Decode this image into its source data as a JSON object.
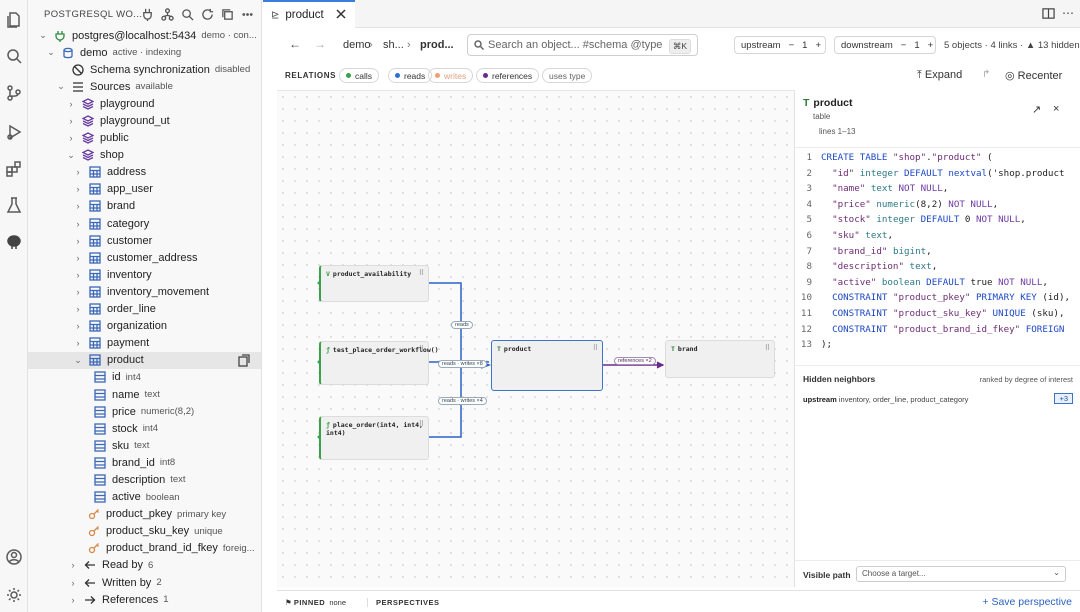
{
  "sidebar": {
    "title": "POSTGRESQL WO...",
    "connection": {
      "label": "postgres@localhost:5434",
      "suffix": "demo · con..."
    },
    "database": {
      "label": "demo",
      "suffix": "active · indexing"
    },
    "schema_sync": {
      "label": "Schema synchronization",
      "suffix": "disabled"
    },
    "sources": {
      "label": "Sources",
      "suffix": "available"
    },
    "schemas": [
      {
        "label": "playground"
      },
      {
        "label": "playground_ut"
      },
      {
        "label": "public"
      },
      {
        "label": "shop"
      }
    ],
    "tables": [
      {
        "label": "address"
      },
      {
        "label": "app_user"
      },
      {
        "label": "brand"
      },
      {
        "label": "category"
      },
      {
        "label": "customer"
      },
      {
        "label": "customer_address"
      },
      {
        "label": "inventory"
      },
      {
        "label": "inventory_movement"
      },
      {
        "label": "order_line"
      },
      {
        "label": "organization"
      },
      {
        "label": "payment"
      },
      {
        "label": "product"
      }
    ],
    "columns": [
      {
        "label": "id",
        "type": "int4"
      },
      {
        "label": "name",
        "type": "text"
      },
      {
        "label": "price",
        "type": "numeric(8,2)"
      },
      {
        "label": "stock",
        "type": "int4"
      },
      {
        "label": "sku",
        "type": "text"
      },
      {
        "label": "brand_id",
        "type": "int8"
      },
      {
        "label": "description",
        "type": "text"
      },
      {
        "label": "active",
        "type": "boolean"
      }
    ],
    "constraints": [
      {
        "label": "product_pkey",
        "type": "primary key"
      },
      {
        "label": "product_sku_key",
        "type": "unique"
      },
      {
        "label": "product_brand_id_fkey",
        "type": "foreig..."
      }
    ],
    "relations": [
      {
        "label": "Read by",
        "count": "6"
      },
      {
        "label": "Written by",
        "count": "2"
      },
      {
        "label": "References",
        "count": "1"
      }
    ]
  },
  "editor": {
    "tab_label": "product",
    "breadcrumb": [
      "demo",
      "sh...",
      "prod..."
    ],
    "search_placeholder": "Search an object...  #schema  @type",
    "search_shortcut": "⌘K",
    "upstream": {
      "label": "upstream",
      "value": "1"
    },
    "downstream": {
      "label": "downstream",
      "value": "1"
    },
    "counts": "5 objects · 4 links · ▲ 13 hidden",
    "relations_title": "RELATIONS",
    "chips": [
      {
        "label": "calls",
        "color": "#3aa04a"
      },
      {
        "label": "reads",
        "color": "#2e6fd6"
      },
      {
        "label": "writes",
        "color": "#f0a070"
      },
      {
        "label": "references",
        "color": "#6a2a8a"
      },
      {
        "label": "uses type",
        "color": ""
      }
    ],
    "expand_label": "Expand",
    "recenter_label": "Recenter"
  },
  "graph": {
    "nodes": [
      {
        "kind": "V",
        "label": "product_availability"
      },
      {
        "kind": "ƒ",
        "label": "test_place_order_workflow()"
      },
      {
        "kind": "ƒ",
        "label": "place_order(int4, int4, int4)"
      },
      {
        "kind": "T",
        "label": "product"
      },
      {
        "kind": "T",
        "label": "brand"
      }
    ],
    "edges": [
      {
        "label": "reads"
      },
      {
        "label": "reads · writes ×8"
      },
      {
        "label": "reads · writes ×4"
      },
      {
        "label": "references ×2"
      }
    ]
  },
  "panel": {
    "kind": "T",
    "title": "product",
    "type": "table",
    "lines": "lines 1–13",
    "code": [
      {
        "n": "1",
        "t": "CREATE TABLE \"shop\".\"product\" ("
      },
      {
        "n": "2",
        "t": "  \"id\" integer DEFAULT nextval('shop.product"
      },
      {
        "n": "3",
        "t": "  \"name\" text NOT NULL,"
      },
      {
        "n": "4",
        "t": "  \"price\" numeric(8,2) NOT NULL,"
      },
      {
        "n": "5",
        "t": "  \"stock\" integer DEFAULT 0 NOT NULL,"
      },
      {
        "n": "6",
        "t": "  \"sku\" text,"
      },
      {
        "n": "7",
        "t": "  \"brand_id\" bigint,"
      },
      {
        "n": "8",
        "t": "  \"description\" text,"
      },
      {
        "n": "9",
        "t": "  \"active\" boolean DEFAULT true NOT NULL,"
      },
      {
        "n": "10",
        "t": "  CONSTRAINT \"product_pkey\" PRIMARY KEY (id),"
      },
      {
        "n": "11",
        "t": "  CONSTRAINT \"product_sku_key\" UNIQUE (sku),"
      },
      {
        "n": "12",
        "t": "  CONSTRAINT \"product_brand_id_fkey\" FOREIGN"
      },
      {
        "n": "13",
        "t": ");"
      }
    ],
    "hidden_title": "Hidden neighbors",
    "hidden_rank": "ranked by degree of interest",
    "hidden_dir": "upstream",
    "hidden_items": "inventory, order_line, product_category",
    "hidden_more": "+3",
    "visible_path_label": "Visible path",
    "visible_path_placeholder": "Choose a target..."
  },
  "bottom": {
    "pinned_label": "PINNED",
    "pinned_value": "none",
    "perspectives_label": "PERSPECTIVES",
    "save_label": "+ Save perspective"
  }
}
